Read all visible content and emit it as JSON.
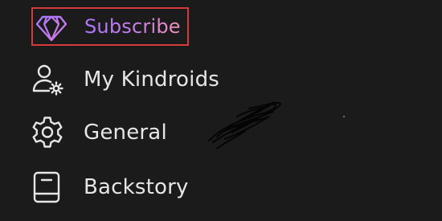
{
  "menu": {
    "items": [
      {
        "label": "Subscribe",
        "icon": "diamond-icon",
        "highlighted": true
      },
      {
        "label": "My Kindroids",
        "icon": "user-settings-icon"
      },
      {
        "label": "General",
        "icon": "gear-icon"
      },
      {
        "label": "Backstory",
        "icon": "book-icon"
      }
    ]
  },
  "colors": {
    "background": "#1b1b1b",
    "text": "#e6e6e6",
    "highlight_border": "#d53a3a",
    "subscribe_gradient_start": "#a977ff",
    "subscribe_gradient_end": "#f08fb6"
  }
}
